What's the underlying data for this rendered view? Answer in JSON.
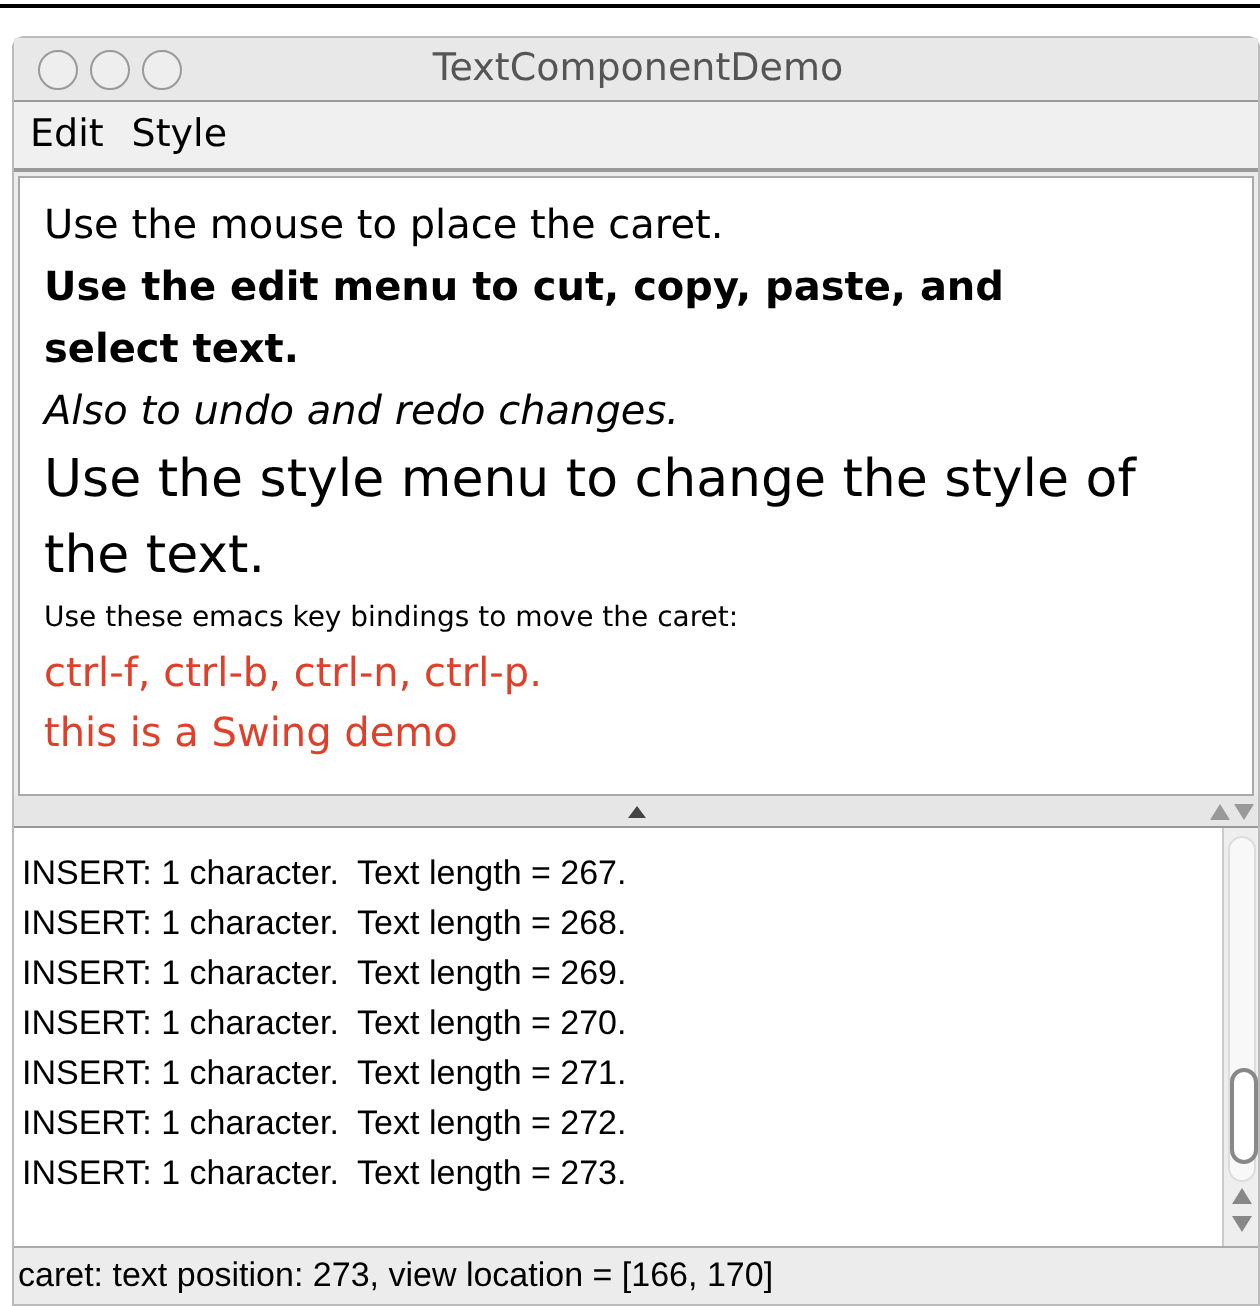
{
  "window": {
    "title": "TextComponentDemo"
  },
  "menu": [
    "Edit",
    "Style"
  ],
  "editor": {
    "paragraphs": [
      {
        "kind": "plain",
        "text": "Use the mouse to place the caret."
      },
      {
        "kind": "bold",
        "text": "Use the edit menu to cut, copy, paste, and select text."
      },
      {
        "kind": "italic",
        "text": "Also to undo and redo changes."
      },
      {
        "kind": "large",
        "text": "Use the style menu to change the style of the text."
      },
      {
        "kind": "small",
        "text": "Use these emacs key bindings to move the caret:"
      },
      {
        "kind": "red",
        "text": "ctrl-f, ctrl-b, ctrl-n, ctrl-p."
      },
      {
        "kind": "red",
        "text": "this is a Swing demo"
      }
    ]
  },
  "log": [
    "INSERT: 1 character.  Text length = 267.",
    "INSERT: 1 character.  Text length = 268.",
    "INSERT: 1 character.  Text length = 269.",
    "INSERT: 1 character.  Text length = 270.",
    "INSERT: 1 character.  Text length = 271.",
    "INSERT: 1 character.  Text length = 272.",
    "INSERT: 1 character.  Text length = 273."
  ],
  "status_bar": "caret: text position: 273, view location = [166, 170]"
}
